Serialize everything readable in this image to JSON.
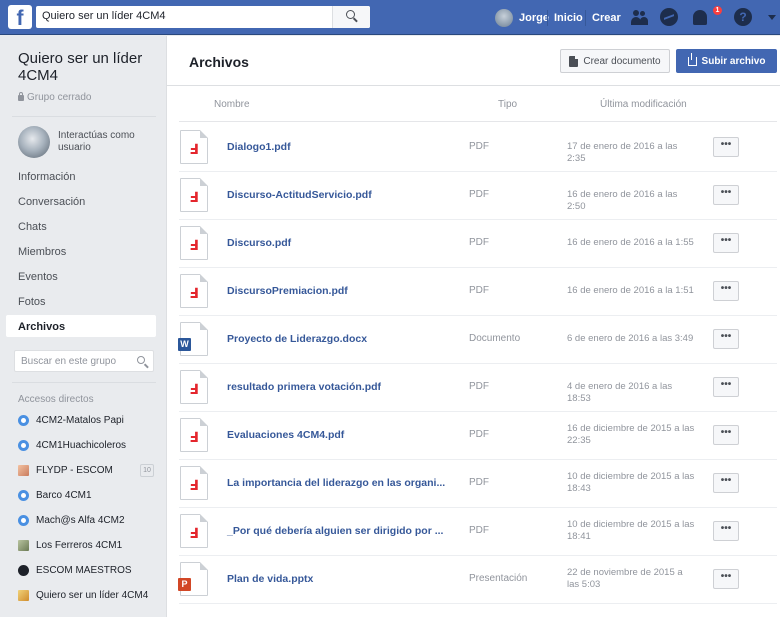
{
  "topbar": {
    "logo": "f",
    "search_value": "Quiero ser un líder 4CM4",
    "user_name": "Jorge",
    "home_label": "Inicio",
    "create_label": "Crear",
    "notification_count": "1",
    "help_symbol": "?"
  },
  "sidebar": {
    "group_title": "Quiero ser un líder 4CM4",
    "group_type": "Grupo cerrado",
    "interacting_as": "Interactúas como usuario",
    "nav": [
      "Información",
      "Conversación",
      "Chats",
      "Miembros",
      "Eventos",
      "Fotos",
      "Archivos"
    ],
    "search_placeholder": "Buscar en este grupo",
    "shortcuts_title": "Accesos directos",
    "shortcuts": [
      {
        "label": "4CM2-Matalos Papi",
        "icon": "group-icon"
      },
      {
        "label": "4CM1Huachicoleros",
        "icon": "group-icon"
      },
      {
        "label": "FLYDP - ESCOM",
        "icon": "group-photo-icon",
        "count": "10"
      },
      {
        "label": "Barco 4CM1",
        "icon": "group-icon"
      },
      {
        "label": "Mach@s Alfa 4CM2",
        "icon": "group-icon"
      },
      {
        "label": "Los Ferreros 4CM1",
        "icon": "group-photo-icon"
      },
      {
        "label": "ESCOM MAESTROS",
        "icon": "group-icon"
      },
      {
        "label": "Quiero ser un líder 4CM4",
        "icon": "group-photo-icon"
      }
    ]
  },
  "main": {
    "title": "Archivos",
    "create_doc_label": "Crear documento",
    "upload_label": "Subir archivo",
    "columns": {
      "name": "Nombre",
      "type": "Tipo",
      "modified": "Última modificación"
    },
    "more_label": "•••",
    "files": [
      {
        "name": "Dialogo1.pdf",
        "type": "PDF",
        "date": "17 de enero de 2016 a las 2:35",
        "icon": "pdf"
      },
      {
        "name": "Discurso-ActitudServicio.pdf",
        "type": "PDF",
        "date": "16 de enero de 2016 a las 2:50",
        "icon": "pdf"
      },
      {
        "name": "Discurso.pdf",
        "type": "PDF",
        "date": "16 de enero de 2016 a la 1:55",
        "icon": "pdf"
      },
      {
        "name": "DiscursoPremiacion.pdf",
        "type": "PDF",
        "date": "16 de enero de 2016 a la 1:51",
        "icon": "pdf"
      },
      {
        "name": "Proyecto de Liderazgo.docx",
        "type": "Documento",
        "date": "6 de enero de 2016 a las 3:49",
        "icon": "word"
      },
      {
        "name": "resultado primera votación.pdf",
        "type": "PDF",
        "date": "4 de enero de 2016 a las 18:53",
        "icon": "pdf"
      },
      {
        "name": "Evaluaciones 4CM4.pdf",
        "type": "PDF",
        "date": "16 de diciembre de 2015 a las 22:35",
        "icon": "pdf"
      },
      {
        "name": "La importancia del liderazgo en las organi...",
        "type": "PDF",
        "date": "10 de diciembre de 2015 a las 18:43",
        "icon": "pdf"
      },
      {
        "name": "_Por qué debería alguien ser dirigido por ...",
        "type": "PDF",
        "date": "10 de diciembre de 2015 a las 18:41",
        "icon": "pdf"
      },
      {
        "name": "Plan de vida.pptx",
        "type": "Presentación",
        "date": "22 de noviembre de 2015 a las 5:03",
        "icon": "ppt"
      }
    ]
  }
}
